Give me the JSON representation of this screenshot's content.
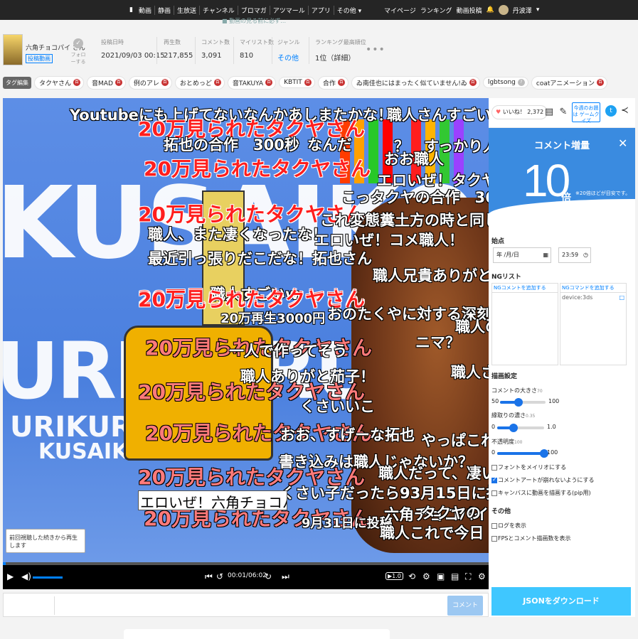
{
  "topbar": {
    "nav": [
      "動画",
      "静画",
      "生放送",
      "チャンネル",
      "ブロマガ",
      "アツマール",
      "アプリ",
      "その他 ▾"
    ],
    "right": [
      "マイページ",
      "ランキング",
      "動画投稿"
    ],
    "user_name": "丹波澤",
    "sub_ticker": "■ 動画の見る前に必ず…"
  },
  "owner": {
    "name": "六角チョコパイ さん",
    "badge": "投稿動画",
    "follow": "フォローする"
  },
  "stats": [
    {
      "label": "投稿日時",
      "value": "2021/09/03 00:15"
    },
    {
      "label": "再生数",
      "value": "217,855"
    },
    {
      "label": "コメント数",
      "value": "3,091"
    },
    {
      "label": "マイリスト数",
      "value": "810"
    },
    {
      "label": "ジャンル",
      "value": "その他"
    },
    {
      "label": "ランキング最高順位",
      "value": "1位（詳細）"
    }
  ],
  "tag_edit": "タグ編集",
  "tags": [
    {
      "label": "タクヤさん",
      "dic": "百"
    },
    {
      "label": "音MAD",
      "dic": "百"
    },
    {
      "label": "例のアレ",
      "dic": "百"
    },
    {
      "label": "おとめっど",
      "dic": "百"
    },
    {
      "label": "音TAKUYA",
      "dic": "百"
    },
    {
      "label": "KBTIT",
      "dic": "百"
    },
    {
      "label": "合作",
      "dic": "百"
    },
    {
      "label": "ゐ南佳也にはまったく似ていません!ゐ",
      "dic": "百"
    },
    {
      "label": "lgbtsong",
      "dic": "?"
    },
    {
      "label": "coatアニメーション",
      "dic": "百"
    }
  ],
  "video_bg": {
    "kusa": "KUSAIKO",
    "uri": "URIKURU",
    "small1": "URIKURU",
    "small2": "KUSAIKO"
  },
  "danmaku": [
    {
      "text": "Youtubeにも上げてないなんかあしまたかな！",
      "cls": "n"
    },
    {
      "text": "職人さんすごいね",
      "cls": "n"
    },
    {
      "text": "20万見られたタクヤさん",
      "cls": "red"
    },
    {
      "text": "拓也の合作　300秒",
      "cls": "n"
    },
    {
      "text": "なんだ",
      "cls": "n"
    },
    {
      "text": "？　すっかり人",
      "cls": "n"
    },
    {
      "text": "おお職人",
      "cls": "n"
    },
    {
      "text": "20万見られたタクヤさん",
      "cls": "red"
    },
    {
      "text": "エロいぜ！タクヤ！",
      "cls": "n"
    },
    {
      "text": "こっタクヤの合作　362秒",
      "cls": "n"
    },
    {
      "text": "20万見られたタクヤさん",
      "cls": "red"
    },
    {
      "text": "これ変態糞土方の時と同じ概要",
      "cls": "n"
    },
    {
      "text": "職人、また凄くなったな！",
      "cls": "n"
    },
    {
      "text": "エロいぜ！コメ職人！",
      "cls": "n"
    },
    {
      "text": "最近引っ張りだこだな！拓也さん",
      "cls": "n"
    },
    {
      "text": "20万見られたタクヤさん",
      "cls": "red"
    },
    {
      "text": "職人兄貴ありがとナス",
      "cls": "n"
    },
    {
      "text": "職人すごいw",
      "cls": "n"
    },
    {
      "text": "20万見られたタクヤさん",
      "cls": "red"
    },
    {
      "text": "おのたくやに対する深刻な風評被害",
      "cls": "n"
    },
    {
      "text": "20万再生3000円",
      "cls": "s"
    },
    {
      "text": "職人の",
      "cls": "n"
    },
    {
      "text": "20万見られたタクヤさん",
      "cls": "pink"
    },
    {
      "text": "ニマ？",
      "cls": "n"
    },
    {
      "text": "一人で作ってそう",
      "cls": "n"
    },
    {
      "text": "職人さ",
      "cls": "n"
    },
    {
      "text": "職人ありがと茄子！",
      "cls": "n"
    },
    {
      "text": "20万見られたタクヤさん",
      "cls": "pink"
    },
    {
      "text": "くさいいこ",
      "cls": "n"
    },
    {
      "text": "20万見られたタクヤさん",
      "cls": "pink"
    },
    {
      "text": "おお、すげーな拓也",
      "cls": "n"
    },
    {
      "text": "やっぱこれだ",
      "cls": "n"
    },
    {
      "text": "書き込みは職人じゃないか？",
      "cls": "n"
    },
    {
      "text": "20万見られたタクヤさん",
      "cls": "pink"
    },
    {
      "text": "職人だって、凄いね",
      "cls": "n"
    },
    {
      "text": "くさい子だったら93月15日に投稿しろ",
      "cls": "n"
    },
    {
      "text": "20万見られたタクヤさん",
      "cls": "pink"
    },
    {
      "text": "9月31日に投稿",
      "cls": "s"
    },
    {
      "text": "六角チョコパイ",
      "cls": "n"
    },
    {
      "text": "職人これで今日",
      "cls": "n"
    },
    {
      "text": "タクヤの",
      "cls": "n"
    }
  ],
  "overlay_box": "エロいぜ！六角チョコパイ！",
  "resume": "前回視聴した続きから再生します",
  "player": {
    "time": "00:01/06:02",
    "speed": "▶1.0",
    "progress": 0.003
  },
  "comment_bar": {
    "placeholder": "",
    "button": "コメント"
  },
  "side": {
    "like_label": "いいね！",
    "like_count": "2,372",
    "quiz": "今週のお題は ゲームクイズ",
    "panel_title": "コメント増量",
    "panel_number": "10",
    "panel_unit": "倍",
    "panel_note": "※20倍ほどが目安です。",
    "start_label": "始点",
    "date_value": "年 /月/日",
    "time_value": "23:59",
    "ng_title": "NGリスト",
    "ng_comment_hd": "NGコメントを追加する",
    "ng_command_hd": "NGコマンドを追加する",
    "ng_command_item": "device:3ds",
    "draw_title": "描画設定",
    "size_label": "コメントの大きさ",
    "size_hint": "70",
    "size_min": "50",
    "size_max": "100",
    "size_value": 70,
    "edge_label": "縁取りの濃さ",
    "edge_hint": "0.35",
    "edge_min": "0",
    "edge_max": "1.0",
    "edge_value": 0.35,
    "opacity_label": "不透明度",
    "opacity_hint": "100",
    "opacity_min": "0",
    "opacity_max": "100",
    "opacity_value": 100,
    "checks": [
      {
        "label": "フォントをメイリオにする",
        "on": false
      },
      {
        "label": "コメントアートが崩れないようにする",
        "on": true
      },
      {
        "label": "キャンバスに動画を描画する(pip用)",
        "on": false
      }
    ],
    "other_title": "その他",
    "checks2": [
      {
        "label": "ログを表示",
        "on": false
      },
      {
        "label": "FPSとコメント描画数を表示",
        "on": false
      }
    ],
    "json_button": "JSONをダウンロード"
  }
}
